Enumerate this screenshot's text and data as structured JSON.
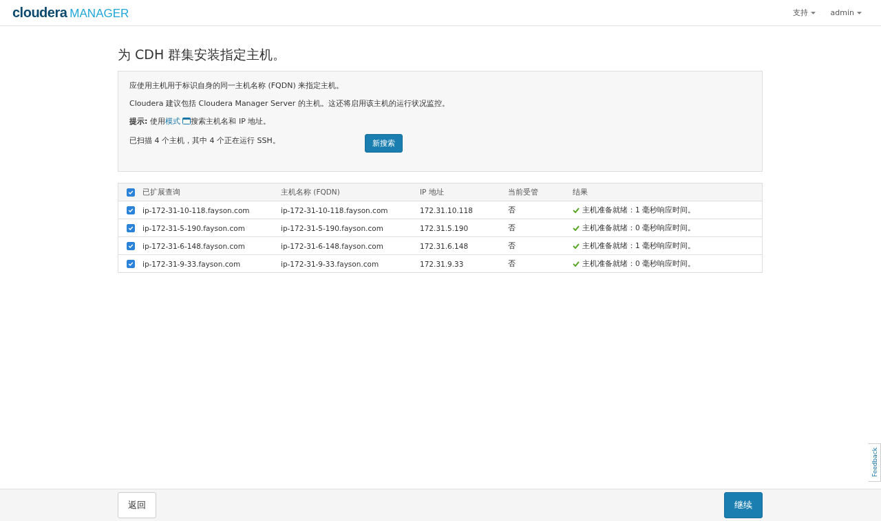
{
  "header": {
    "logo_main": "cloudera",
    "logo_sub": "MANAGER",
    "menus": [
      {
        "label": "支持"
      },
      {
        "label": "admin"
      }
    ]
  },
  "title": "为 CDH 群集安装指定主机。",
  "info": {
    "lines": [
      "应使用主机用于标识自身的同一主机名称 (FQDN) 来指定主机。",
      "Cloudera 建议包括 Cloudera Manager Server 的主机。这还将启用该主机的运行状况监控。"
    ],
    "hint": {
      "label": "提示:",
      "before": " 使用",
      "link": "模式",
      "after": "搜索主机名和 IP 地址。"
    },
    "scan": "已扫描 4 个主机，其中 4 个正在运行 SSH。",
    "search_button": "新搜索"
  },
  "table": {
    "all_checked": true,
    "columns": [
      "已扩展查询",
      "主机名称 (FQDN)",
      "IP 地址",
      "当前受管",
      "结果"
    ],
    "rows": [
      {
        "checked": true,
        "query": "ip-172-31-10-118.fayson.com",
        "fqdn": "ip-172-31-10-118.fayson.com",
        "ip": "172.31.10.118",
        "managed": "否",
        "result": "主机准备就绪：1 毫秒响应时间。"
      },
      {
        "checked": true,
        "query": "ip-172-31-5-190.fayson.com",
        "fqdn": "ip-172-31-5-190.fayson.com",
        "ip": "172.31.5.190",
        "managed": "否",
        "result": "主机准备就绪：0 毫秒响应时间。"
      },
      {
        "checked": true,
        "query": "ip-172-31-6-148.fayson.com",
        "fqdn": "ip-172-31-6-148.fayson.com",
        "ip": "172.31.6.148",
        "managed": "否",
        "result": "主机准备就绪：1 毫秒响应时间。"
      },
      {
        "checked": true,
        "query": "ip-172-31-9-33.fayson.com",
        "fqdn": "ip-172-31-9-33.fayson.com",
        "ip": "172.31.9.33",
        "managed": "否",
        "result": "主机准备就绪：0 毫秒响应时间。"
      }
    ]
  },
  "feedback": "Feedback",
  "footer": {
    "back": "返回",
    "continue": "继续"
  }
}
